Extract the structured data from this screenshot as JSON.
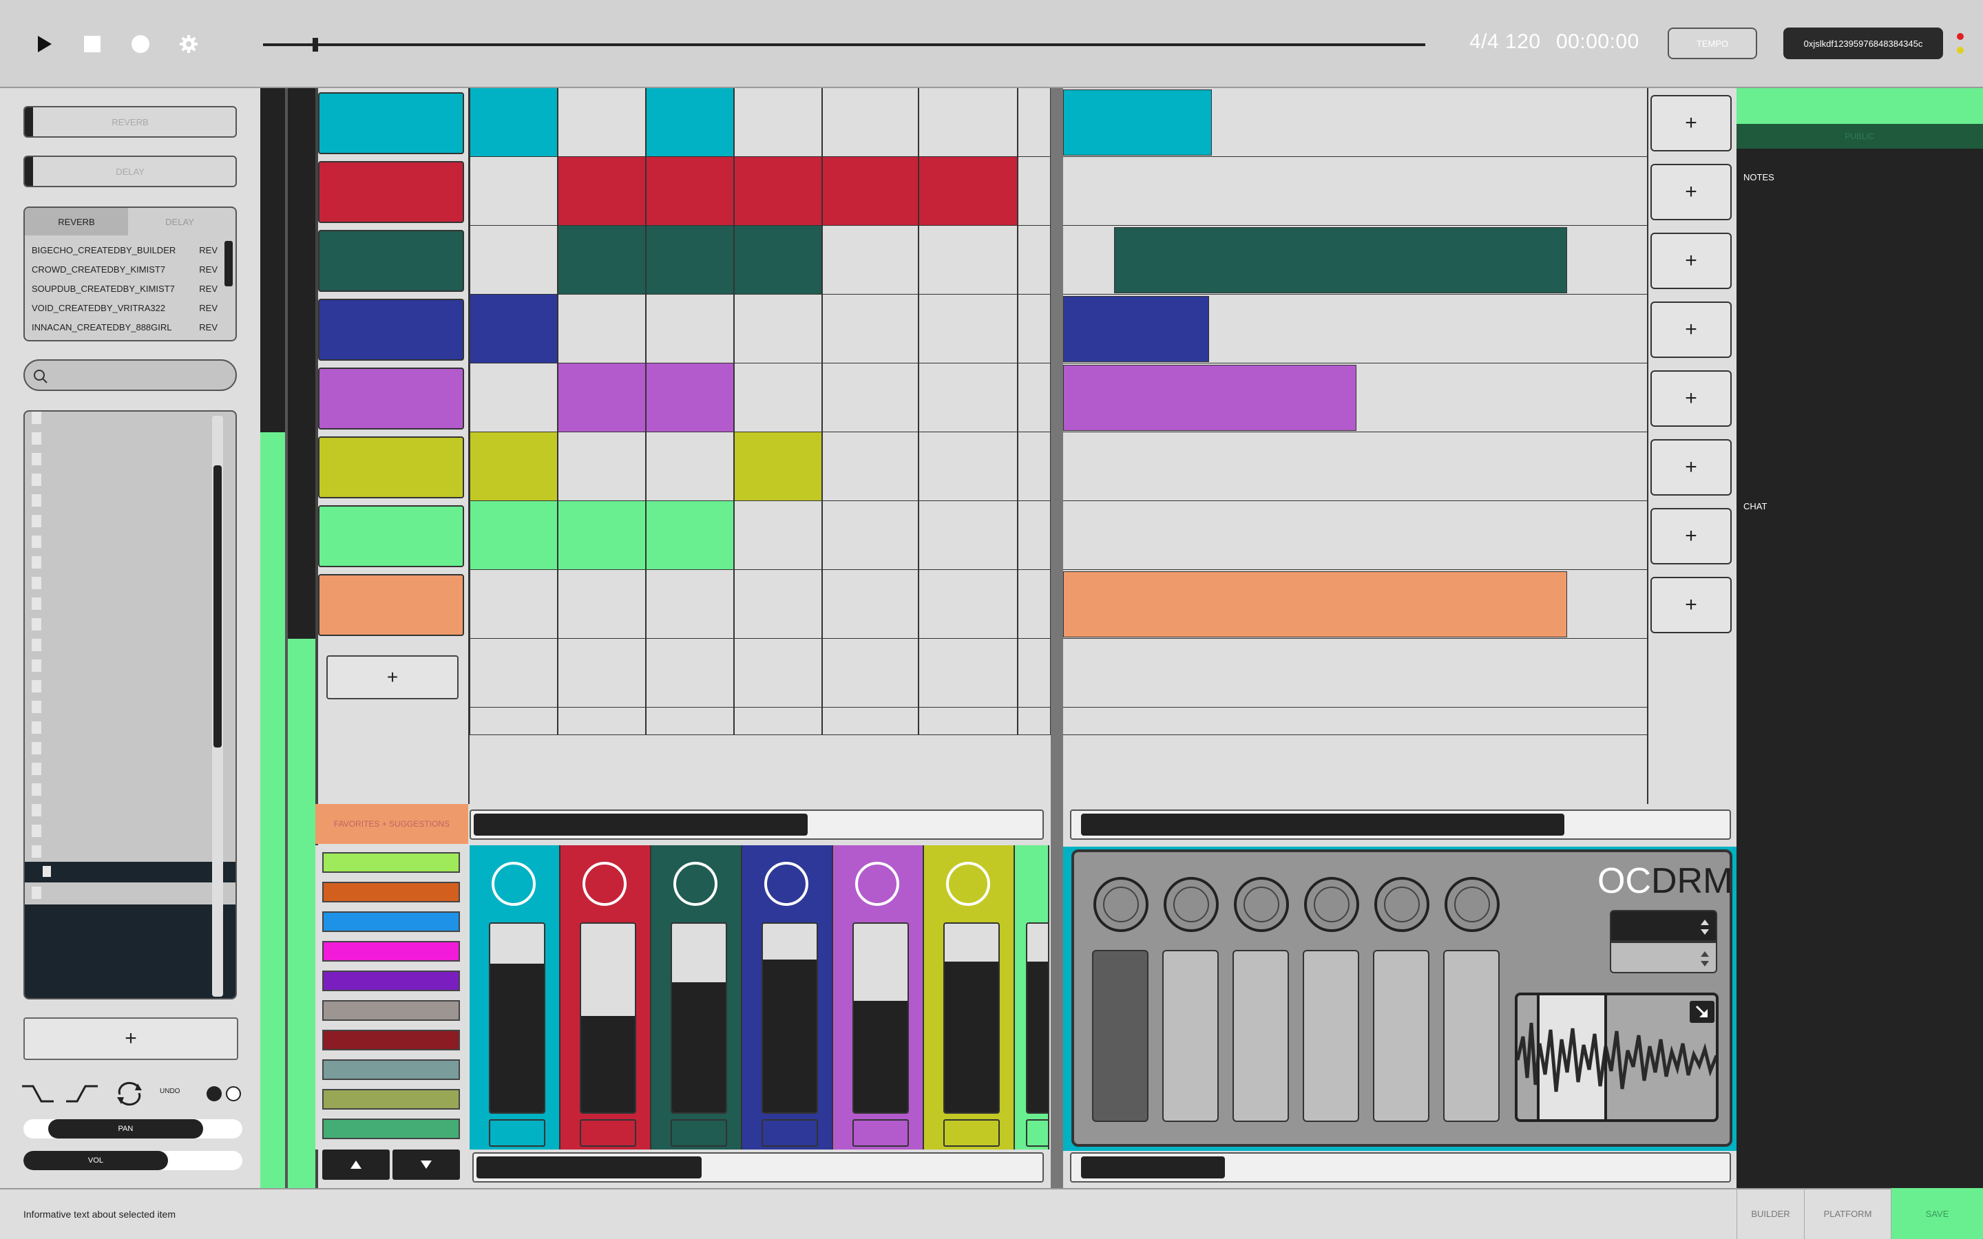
{
  "transport": {
    "play_icon": "play-icon",
    "stop_icon": "stop-icon",
    "record_icon": "record-icon",
    "settings_icon": "gear-icon",
    "time_signature_bpm": "4/4 120",
    "time": "00:00:00",
    "tempo_label": "TEMPO",
    "wallet_address": "0xjslkdf12395976848384345c",
    "playhead_progress": 0.045
  },
  "left": {
    "fx_slots": [
      "REVERB",
      "DELAY"
    ],
    "preset_tabs": [
      "REVERB",
      "DELAY"
    ],
    "presets": [
      {
        "name": "BIGECHO_CREATEDBY_BUILDER",
        "tag": "REV"
      },
      {
        "name": "CROWD_CREATEDBY_KIMIST7",
        "tag": "REV"
      },
      {
        "name": "SOUPDUB_CREATEDBY_KIMIST7",
        "tag": "REV"
      },
      {
        "name": "VOID_CREATEDBY_VRITRA322",
        "tag": "REV"
      },
      {
        "name": "INNACAN_CREATEDBY_888GIRL",
        "tag": "REV"
      }
    ],
    "search_placeholder": "",
    "add_label": "+",
    "undo_label": "UNDO",
    "pan_label": "PAN",
    "vol_label": "VOL",
    "pan_value": 0.82,
    "vol_value": 0.66
  },
  "tracks": {
    "colors": [
      "#00b2c3",
      "#c62339",
      "#205c52",
      "#2d3899",
      "#b35bcc",
      "#c3c924",
      "#69ef90",
      "#ef9a6a"
    ],
    "add_track_label": "+",
    "add_scene_label": "+",
    "favorites_label": "FAVORITES + SUGGESTIONS",
    "clip_scroll": 0.59,
    "arrange_scroll": 0.74,
    "mixer_scroll": 0.4,
    "instrument_scroll": 0.22
  },
  "swatches": [
    "#9eea5a",
    "#d35f1f",
    "#1e92e6",
    "#f21bd9",
    "#7b1ebf",
    "#9d9592",
    "#8b1c23",
    "#7a9c9b",
    "#98a756",
    "#43ad75"
  ],
  "mixer": {
    "levels": [
      0.79,
      0.51,
      0.69,
      0.81,
      0.59,
      0.8,
      0.8
    ]
  },
  "instrument": {
    "logo_prefix": "OC",
    "logo_suffix": "DRM",
    "expand_icon": "expand-arrow-icon"
  },
  "right": {
    "visibility_label": "PUBLIC",
    "notes_label": "NOTES",
    "chat_label": "CHAT"
  },
  "footer": {
    "info_text": "Informative text about selected item",
    "tabs": [
      "BUILDER",
      "PLATFORM",
      "SAVE"
    ]
  }
}
